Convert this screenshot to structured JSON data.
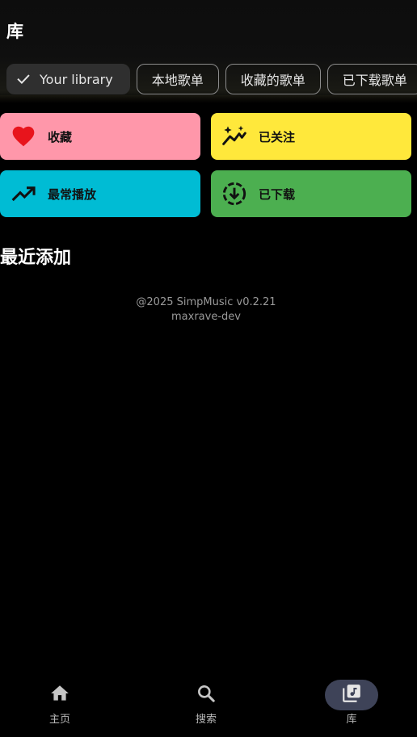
{
  "header": {
    "title": "库"
  },
  "chips": [
    {
      "label": "Your library",
      "selected": true
    },
    {
      "label": "本地歌单",
      "selected": false
    },
    {
      "label": "收藏的歌单",
      "selected": false
    },
    {
      "label": "已下载歌单",
      "selected": false
    }
  ],
  "tiles": {
    "favorites": {
      "label": "收藏",
      "icon": "heart-icon",
      "color": "#ff97aa"
    },
    "followed": {
      "label": "已关注",
      "icon": "sparkle-trend-icon",
      "color": "#ffe83b"
    },
    "most_played": {
      "label": "最常播放",
      "icon": "trending-up-icon",
      "color": "#00bcd4"
    },
    "downloaded": {
      "label": "已下载",
      "icon": "download-circle-icon",
      "color": "#4caf50"
    }
  },
  "recent": {
    "title": "最近添加"
  },
  "credits": {
    "line1": "@2025 SimpMusic v0.2.21",
    "line2": "maxrave-dev"
  },
  "bottom_nav": {
    "items": [
      {
        "label": "主页",
        "icon": "home-icon",
        "active": false
      },
      {
        "label": "搜索",
        "icon": "search-icon",
        "active": false
      },
      {
        "label": "库",
        "icon": "library-music-icon",
        "active": true
      }
    ]
  },
  "colors": {
    "background": "#000000",
    "active_nav_pill": "#3e4358",
    "heart_red": "#e8141c"
  }
}
